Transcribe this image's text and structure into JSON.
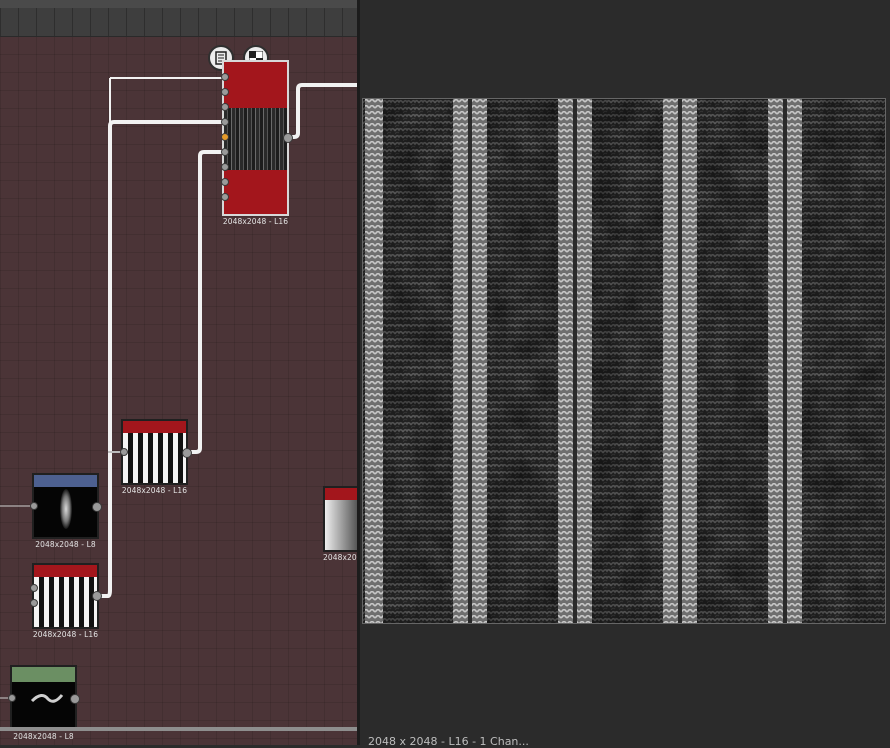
{
  "graph": {
    "toolbar_icons": [
      "document-icon",
      "checker-icon"
    ],
    "nodes": [
      {
        "id": "blend-node",
        "resolution": "2048x2048 - L16"
      },
      {
        "id": "stripes-node-top",
        "resolution": "2048x2048 - L16"
      },
      {
        "id": "noise-node",
        "resolution": "2048x2048 - L8"
      },
      {
        "id": "stripes-node-bottom",
        "resolution": "2048x2048 - L16"
      },
      {
        "id": "partial-node",
        "resolution": "2048x20"
      },
      {
        "id": "brush-node",
        "resolution": "2048x2048 - L8"
      }
    ],
    "colors": {
      "background": "#4b3437",
      "header_red": "#a3161c",
      "header_blue": "#4d6090",
      "header_green": "#6b8f63",
      "wire": "#f2f2f2",
      "active_port": "#e59a2a"
    }
  },
  "preview": {
    "status_text": "2048 x 2048 - L16 - 1 Chan..."
  }
}
